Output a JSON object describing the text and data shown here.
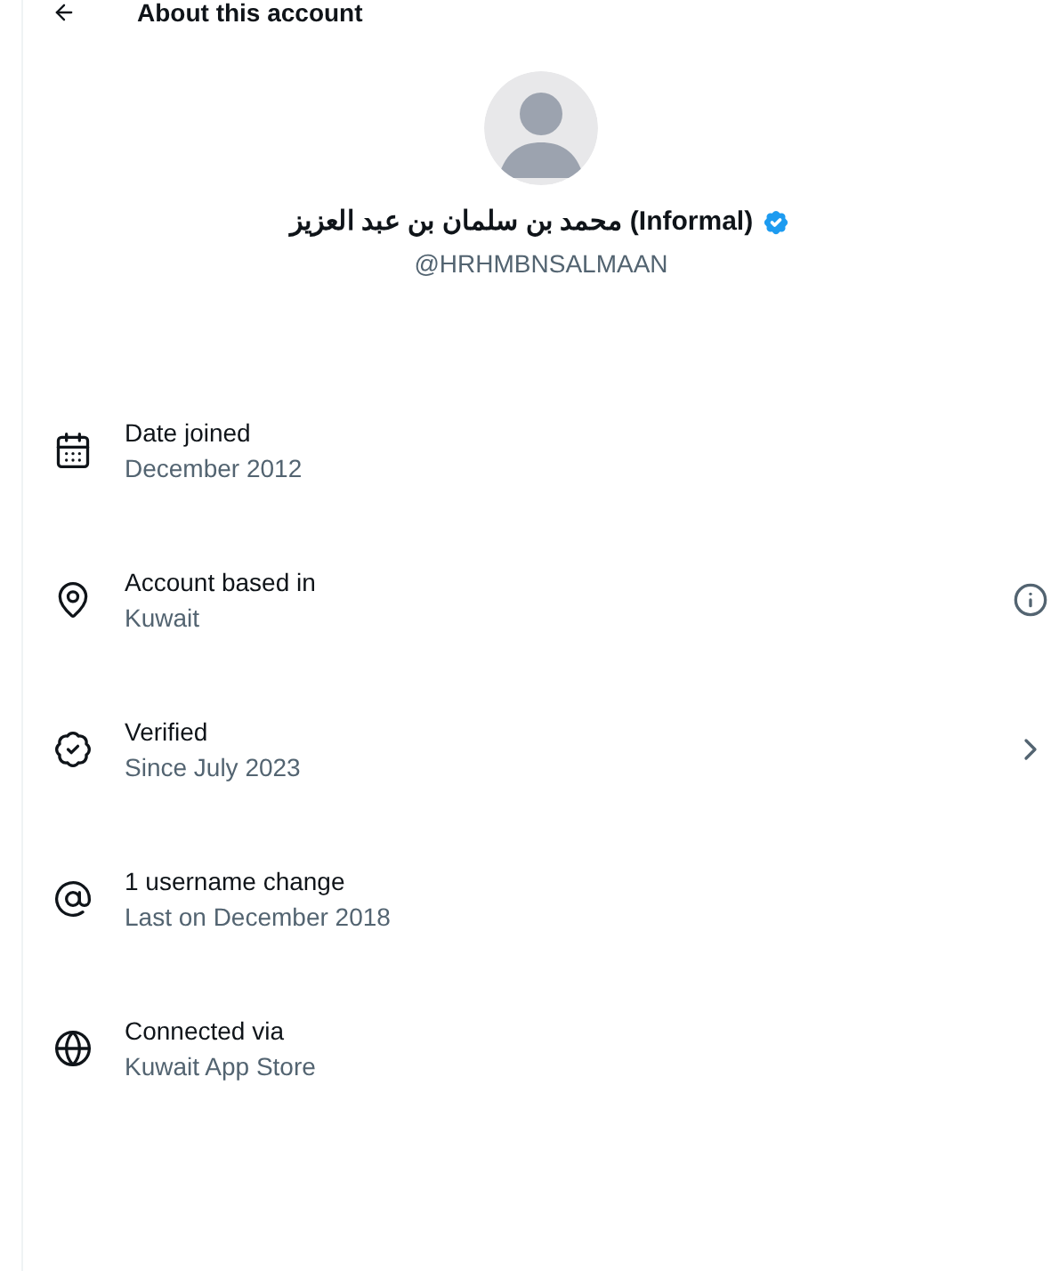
{
  "header": {
    "title": "About this account"
  },
  "profile": {
    "name": "محمد بن سلمان بن عبد العزيز (Informal)",
    "verified": true,
    "handle": "@HRHMBNSALMAAN"
  },
  "rows": [
    {
      "kind": "calendar",
      "label": "Date joined",
      "value": "December 2012"
    },
    {
      "kind": "location",
      "label": "Account based in",
      "value": "Kuwait"
    },
    {
      "kind": "verified",
      "label": "Verified",
      "value": "Since July 2023"
    },
    {
      "kind": "username",
      "label": "1 username change",
      "value": "Last on December 2018"
    },
    {
      "kind": "globe",
      "label": "Connected via",
      "value": "Kuwait App Store"
    }
  ]
}
